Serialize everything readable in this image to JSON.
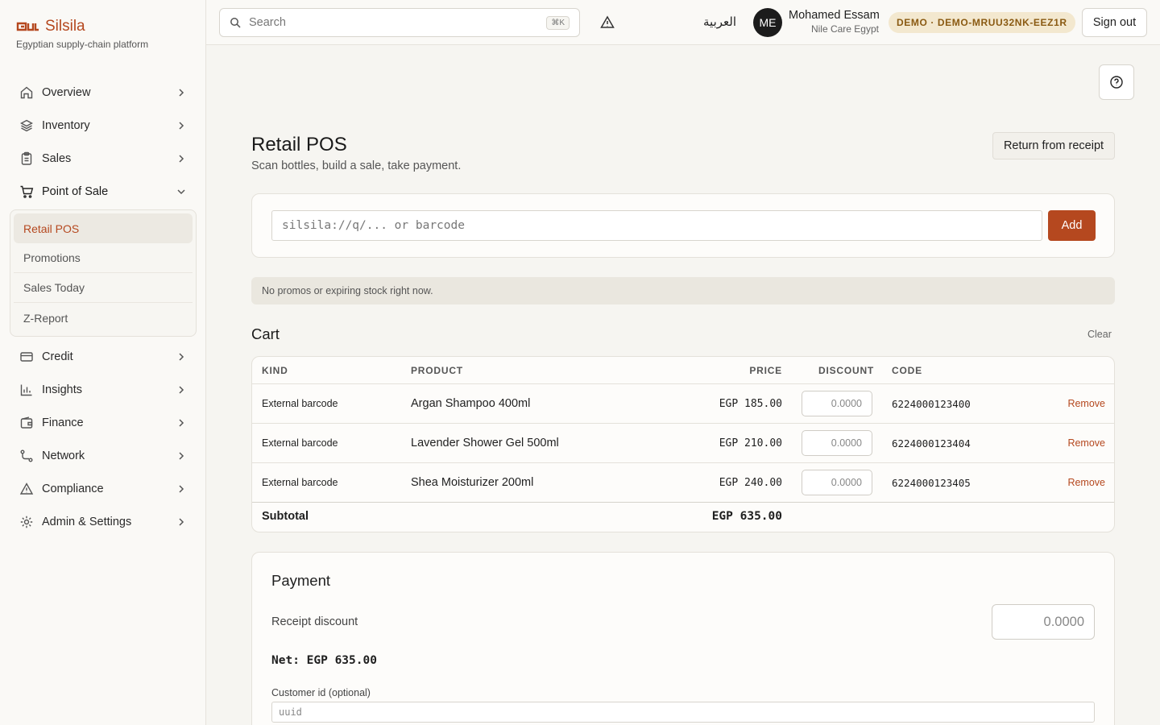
{
  "brand": {
    "name": "Silsila",
    "tagline": "Egyptian supply-chain platform",
    "accent": "#b5481f"
  },
  "sidebar": {
    "items": [
      {
        "label": "Overview",
        "icon": "home-icon"
      },
      {
        "label": "Inventory",
        "icon": "layers-icon"
      },
      {
        "label": "Sales",
        "icon": "clipboard-icon"
      },
      {
        "label": "Point of Sale",
        "icon": "cart-icon",
        "expanded": true,
        "children": [
          {
            "label": "Retail POS",
            "active": true
          },
          {
            "label": "Promotions"
          },
          {
            "label": "Sales Today"
          },
          {
            "label": "Z-Report"
          }
        ]
      },
      {
        "label": "Credit",
        "icon": "credit-card-icon"
      },
      {
        "label": "Insights",
        "icon": "bar-chart-icon"
      },
      {
        "label": "Finance",
        "icon": "wallet-icon"
      },
      {
        "label": "Network",
        "icon": "network-icon"
      },
      {
        "label": "Compliance",
        "icon": "warning-icon"
      },
      {
        "label": "Admin & Settings",
        "icon": "gear-icon"
      }
    ]
  },
  "topbar": {
    "search_placeholder": "Search",
    "search_shortcut": "⌘K",
    "language": "العربية",
    "avatar_initials": "ME",
    "user_name": "Mohamed Essam",
    "user_org": "Nile Care Egypt",
    "demo_badge": "DEMO · DEMO-MRUU32NK-EEZ1R",
    "sign_out": "Sign out"
  },
  "page": {
    "title": "Retail POS",
    "subtitle": "Scan bottles, build a sale, take payment.",
    "return_button": "Return from receipt"
  },
  "scan": {
    "placeholder": "silsila://q/... or barcode",
    "add_label": "Add"
  },
  "notice": "No promos or expiring stock right now.",
  "cart": {
    "title": "Cart",
    "clear_label": "Clear",
    "columns": {
      "kind": "KIND",
      "product": "PRODUCT",
      "price": "PRICE",
      "discount": "DISCOUNT",
      "code": "CODE"
    },
    "rows": [
      {
        "kind": "External barcode",
        "product": "Argan Shampoo 400ml",
        "price": "EGP 185.00",
        "discount": "0.0000",
        "code": "6224000123400",
        "action": "Remove"
      },
      {
        "kind": "External barcode",
        "product": "Lavender Shower Gel 500ml",
        "price": "EGP 210.00",
        "discount": "0.0000",
        "code": "6224000123404",
        "action": "Remove"
      },
      {
        "kind": "External barcode",
        "product": "Shea Moisturizer 200ml",
        "price": "EGP 240.00",
        "discount": "0.0000",
        "code": "6224000123405",
        "action": "Remove"
      }
    ],
    "subtotal_label": "Subtotal",
    "subtotal_value": "EGP 635.00"
  },
  "payment": {
    "title": "Payment",
    "receipt_discount_label": "Receipt discount",
    "receipt_discount_placeholder": "0.0000",
    "net": "Net: EGP 635.00",
    "customer_label": "Customer id (optional)",
    "customer_placeholder": "uuid"
  }
}
